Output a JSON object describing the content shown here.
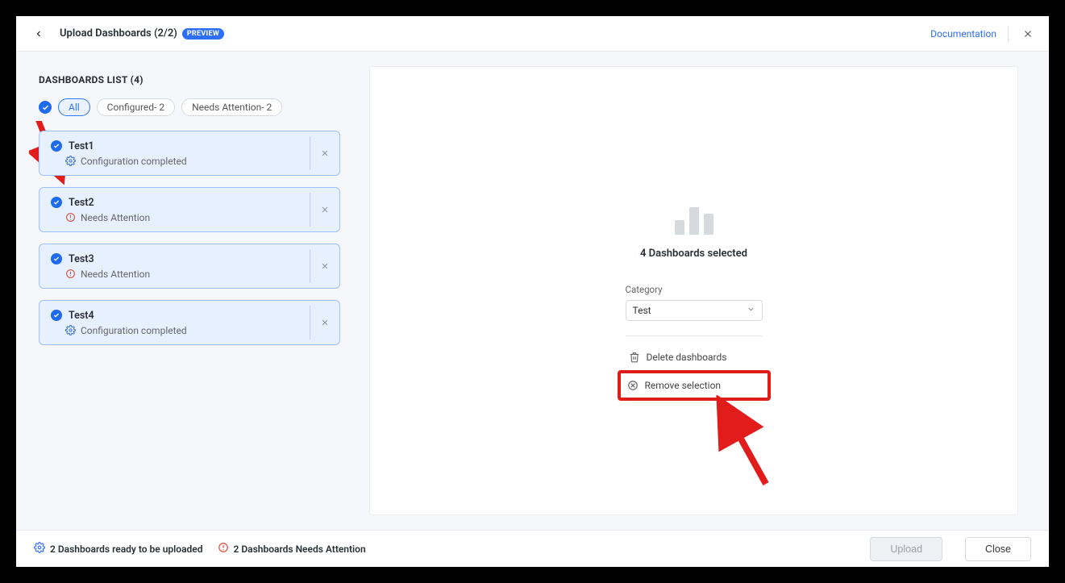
{
  "header": {
    "title": "Upload Dashboards (2/2)",
    "preview_badge": "PREVIEW",
    "doc_link": "Documentation"
  },
  "sidebar": {
    "list_title": "DASHBOARDS LIST (4)",
    "filters": {
      "all": "All",
      "configured": "Configured- 2",
      "needs": "Needs Attention- 2"
    },
    "items": [
      {
        "name": "Test1",
        "status": "Configuration completed",
        "ok": true
      },
      {
        "name": "Test2",
        "status": "Needs Attention",
        "ok": false
      },
      {
        "name": "Test3",
        "status": "Needs Attention",
        "ok": false
      },
      {
        "name": "Test4",
        "status": "Configuration completed",
        "ok": true
      }
    ]
  },
  "main": {
    "selected_text": "4 Dashboards selected",
    "category_label": "Category",
    "category_value": "Test",
    "delete_label": "Delete dashboards",
    "remove_label": "Remove selection"
  },
  "footer": {
    "ready": "2 Dashboards ready to be uploaded",
    "needs": "2 Dashboards Needs Attention",
    "upload": "Upload",
    "close": "Close"
  }
}
